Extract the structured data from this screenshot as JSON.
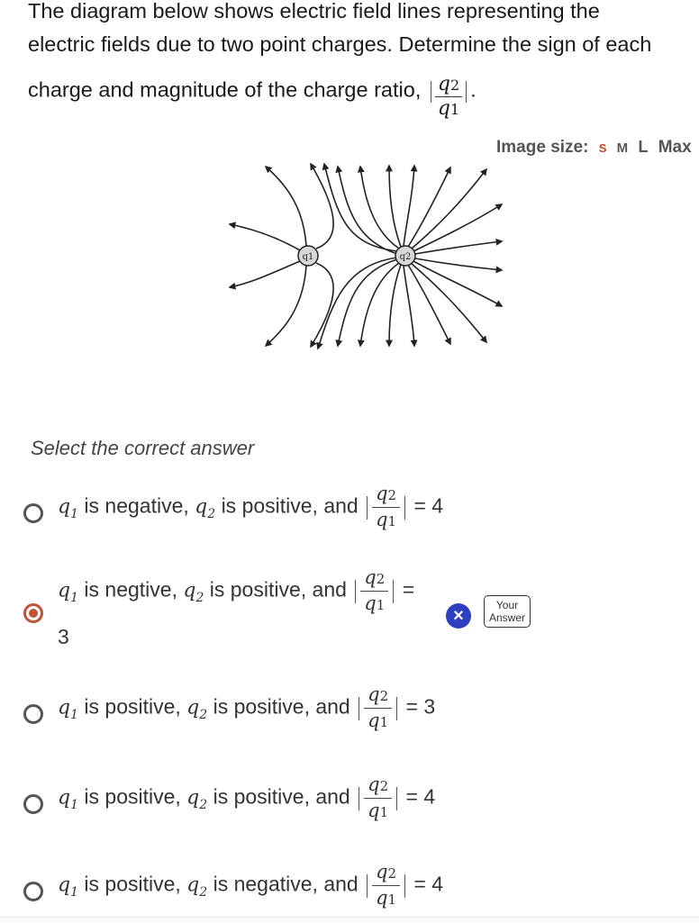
{
  "question": {
    "line1": "The diagram below shows electric field lines representing the",
    "line2": "electric fields due to two point charges.  Determine the sign of each",
    "line3": "charge and magnitude of the charge ratio,",
    "ratio_num": "q2",
    "ratio_den": "q1",
    "trailing": "."
  },
  "image_size": {
    "label": "Image size:",
    "options": [
      "S",
      "M",
      "L",
      "Max"
    ],
    "active": "S",
    "active_color": "#d0402c"
  },
  "diagram": {
    "charge1_label": "q1",
    "charge2_label": "q2",
    "description": "Electric field lines; all lines point outward from both charges; q2 has more lines than q1"
  },
  "select_label": "Select the correct answer",
  "options": [
    {
      "q1_sign": "is negative,",
      "q2_sign": "is positive, and",
      "result": "= 4",
      "selected": false
    },
    {
      "q1_sign": "is negtive,",
      "q2_sign": "is positive, and",
      "result": "=",
      "result_wrap": "3",
      "selected": true
    },
    {
      "q1_sign": "is positive,",
      "q2_sign": "is positive, and",
      "result": "= 3",
      "selected": false
    },
    {
      "q1_sign": "is positive,",
      "q2_sign": "is positive, and",
      "result": "= 4",
      "selected": false
    },
    {
      "q1_sign": "is positive,",
      "q2_sign": "is negative, and",
      "result": "= 4",
      "selected": false
    }
  ],
  "math": {
    "q": "q",
    "sub1": "1",
    "sub2": "2"
  },
  "feedback": {
    "wrong_icon": "×",
    "your_answer_line1": "Your",
    "your_answer_line2": "Answer",
    "wrong_color": "#2f3fbf",
    "selected_color": "#c0533a"
  }
}
